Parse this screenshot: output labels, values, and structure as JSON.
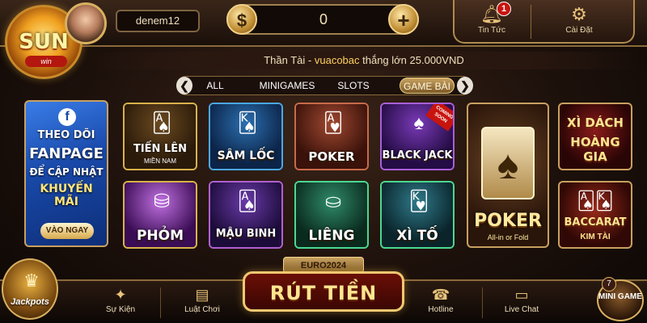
{
  "header": {
    "logo_text": "SUN",
    "logo_sub": "win",
    "username": "denem12",
    "currency_symbol": "$",
    "balance": "0",
    "add_symbol": "+",
    "news_label": "Tin Tức",
    "news_badge": "1",
    "settings_label": "Cài Đặt"
  },
  "ticker": {
    "prefix": "Thần Tài - ",
    "user": "vuacobac",
    "suffix": " thắng lớn 25.000VND"
  },
  "tabs": {
    "all": "ALL",
    "minigames": "MINIGAMES",
    "slots": "SLOTS",
    "game_bai": "GAME BÀI",
    "prev": "❮",
    "next": "❯"
  },
  "fanpage": {
    "icon": "f",
    "line1": "THEO DÕI",
    "line2": "FANPAGE",
    "line3": "ĐỂ CẬP NHẬT",
    "line4": "KHUYẾN MÃI",
    "cta": "VÀO NGAY"
  },
  "games": {
    "tienlen": {
      "name": "TIẾN LÊN",
      "sub": "MIỀN NAM"
    },
    "samloc": {
      "name": "SÂM LỐC"
    },
    "poker": {
      "name": "POKER"
    },
    "blackjack": {
      "name": "BLACK JACK",
      "badge": "COMING SOON"
    },
    "big_poker": {
      "name": "POKER",
      "sub": "All-in or Fold"
    },
    "xidach": {
      "name": "XÌ DÁCH",
      "sub": "HOÀNG GIA"
    },
    "phom": {
      "name": "PHỎM"
    },
    "maubinh": {
      "name": "MẬU BINH"
    },
    "lieng": {
      "name": "LIÊNG"
    },
    "xito": {
      "name": "XÌ TỐ"
    },
    "baccarat": {
      "name": "BACCARAT",
      "sub": "KIM TÀI"
    }
  },
  "bottom": {
    "jackpot": "Jackpots",
    "event": "Sự Kiện",
    "rules": "Luật Chơi",
    "euro": "EURO2024",
    "withdraw": "RÚT TIỀN",
    "hotline": "Hotline",
    "live_chat": "Live Chat",
    "minigame": "MINI GAME",
    "minigame_badge": "7"
  },
  "colors": {
    "accent_gold": "#f0c870",
    "badge_red": "#c8140e",
    "background_dark": "#1c100b"
  }
}
